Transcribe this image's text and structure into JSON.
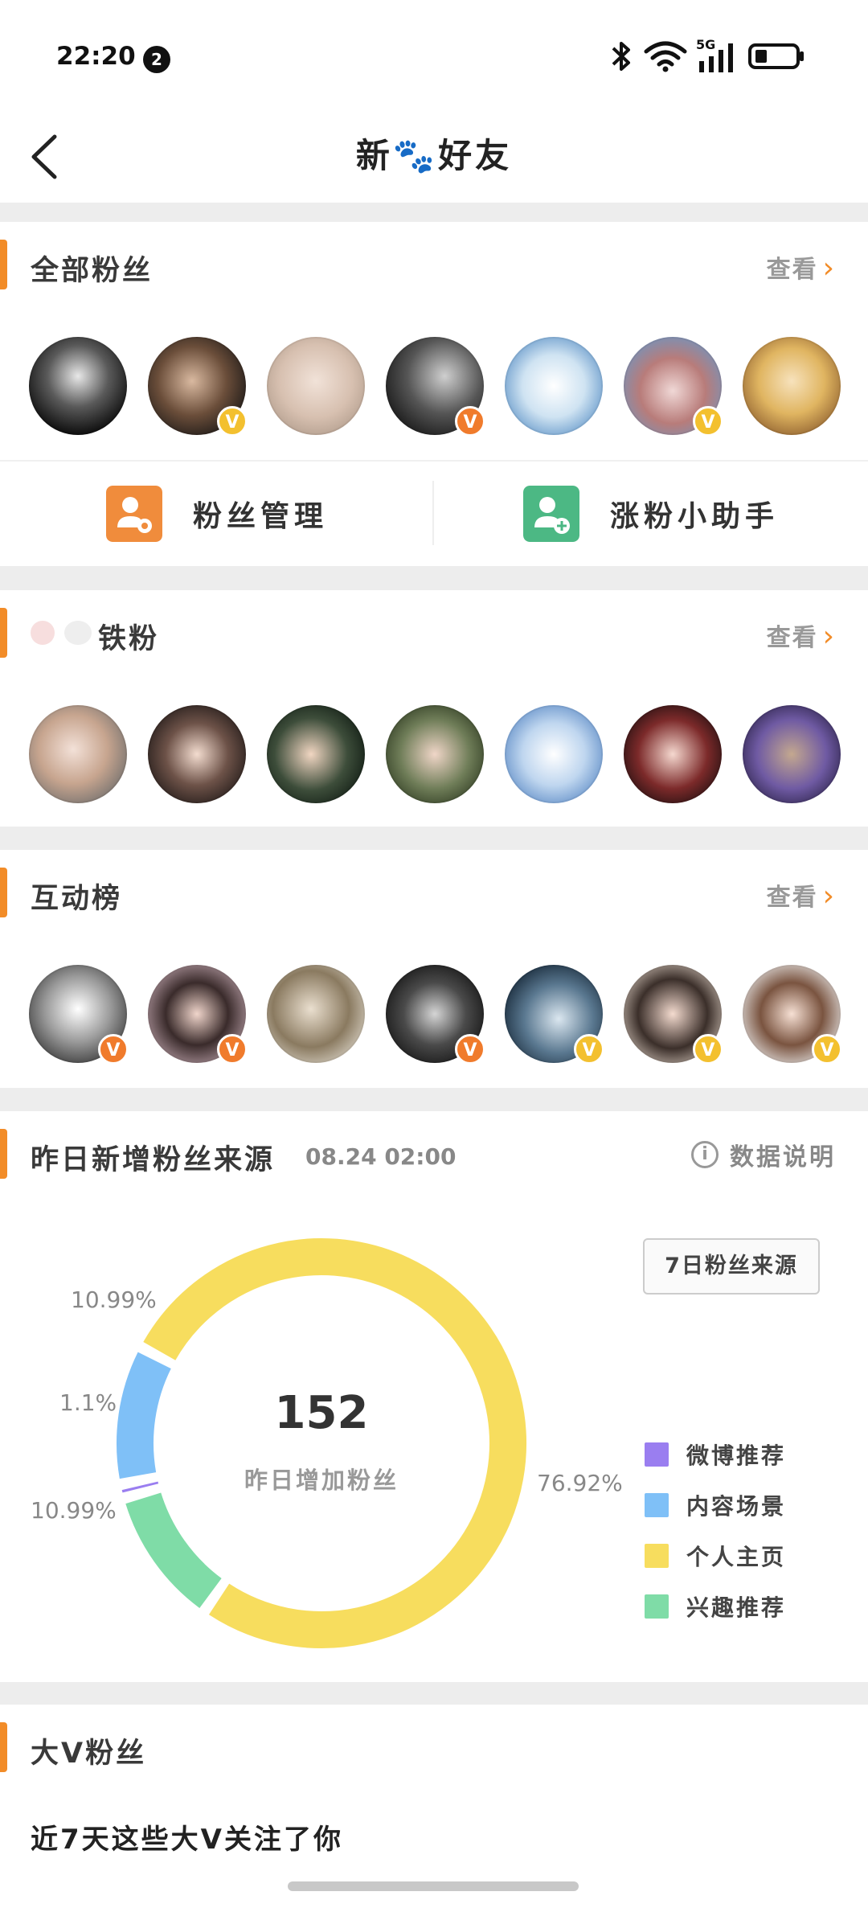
{
  "status_bar": {
    "time": "22:20",
    "notification_count": "2",
    "network": "5G"
  },
  "nav": {
    "title": "新🐾好友",
    "back_icon": "chevron-left-icon"
  },
  "all_fans": {
    "title": "全部粉丝",
    "view_label": "查看",
    "avatars": [
      {
        "badge": ""
      },
      {
        "badge": "yellow"
      },
      {
        "badge": ""
      },
      {
        "badge": "orange"
      },
      {
        "badge": ""
      },
      {
        "badge": "yellow"
      },
      {
        "badge": ""
      }
    ],
    "tools": [
      {
        "label": "粉丝管理",
        "icon": "user-settings-icon",
        "color": "#f08c3c"
      },
      {
        "label": "涨粉小助手",
        "icon": "user-add-icon",
        "color": "#4cb884"
      }
    ]
  },
  "iron_fans": {
    "title": "铁粉",
    "view_label": "查看"
  },
  "interaction": {
    "title": "互动榜",
    "view_label": "查看",
    "avatars": [
      {
        "badge": "orange"
      },
      {
        "badge": "orange"
      },
      {
        "badge": ""
      },
      {
        "badge": "orange"
      },
      {
        "badge": "yellow"
      },
      {
        "badge": "yellow"
      },
      {
        "badge": "yellow"
      }
    ]
  },
  "source": {
    "title": "昨日新增粉丝来源",
    "timestamp": "08.24 02:00",
    "info_label": "数据说明",
    "seven_day_button": "7日粉丝来源",
    "center_value": "152",
    "center_label": "昨日增加粉丝"
  },
  "chart_data": {
    "type": "pie",
    "categories": [
      "微博推荐",
      "内容场景",
      "个人主页",
      "兴趣推荐"
    ],
    "values": [
      1.1,
      10.99,
      76.92,
      10.99
    ],
    "labels": [
      "1.1%",
      "10.99%",
      "76.92%",
      "10.99%"
    ],
    "colors": [
      "#9a7ef0",
      "#7fc0f7",
      "#f7dd5e",
      "#7fdca7"
    ],
    "legend_position": "right"
  },
  "big_v": {
    "title": "大V粉丝",
    "subtitle": "近7天这些大V关注了你"
  },
  "colors": {
    "accent": "#f28c28"
  }
}
